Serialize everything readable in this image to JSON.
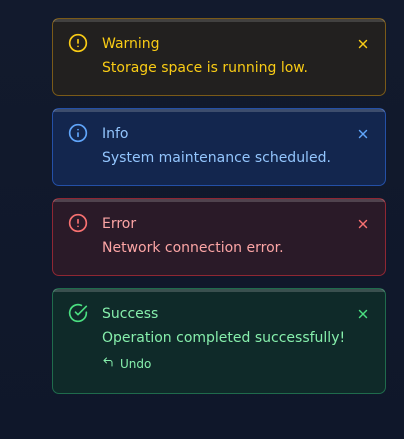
{
  "toasts": [
    {
      "variant": "warning",
      "title": "Warning",
      "message": "Storage space is running low.",
      "icon": "alert-circle-icon",
      "close_icon": "close-icon",
      "accent": "#facc15"
    },
    {
      "variant": "info",
      "title": "Info",
      "message": "System maintenance scheduled.",
      "icon": "info-icon",
      "close_icon": "close-icon",
      "accent": "#60a5fa"
    },
    {
      "variant": "error",
      "title": "Error",
      "message": "Network connection error.",
      "icon": "alert-circle-icon",
      "close_icon": "close-icon",
      "accent": "#f87171"
    },
    {
      "variant": "success",
      "title": "Success",
      "message": "Operation completed successfully!",
      "icon": "check-circle-icon",
      "close_icon": "close-icon",
      "accent": "#4ade80",
      "action": {
        "label": "Undo",
        "icon": "undo-icon"
      }
    }
  ]
}
